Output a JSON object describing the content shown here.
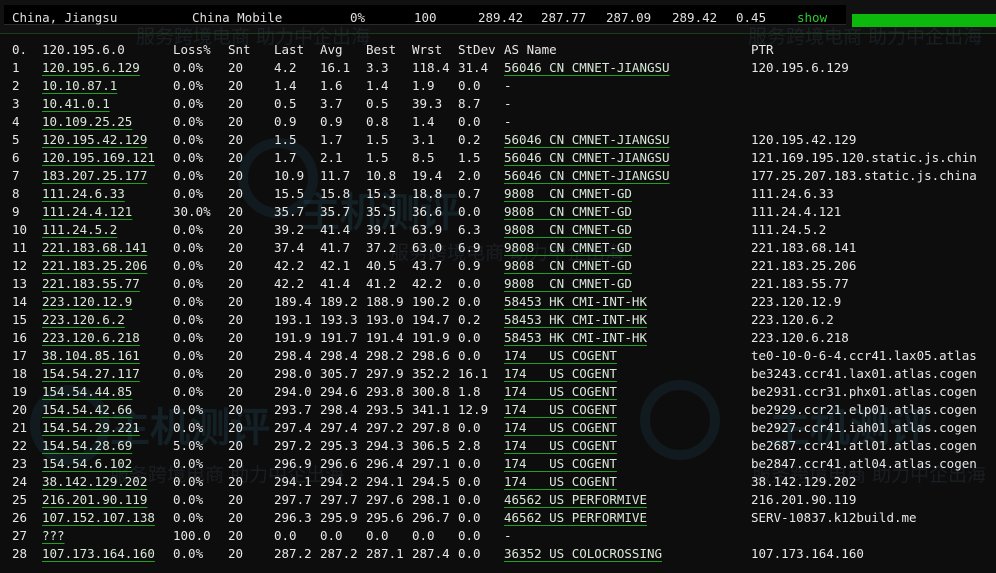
{
  "status": {
    "location": "China, Jiangsu",
    "isp": "China Mobile",
    "loss": "0%",
    "count": "100",
    "v1": "289.42",
    "v2": "287.77",
    "v3": "287.09",
    "v4": "289.42",
    "v5": "0.45",
    "show_label": "show"
  },
  "watermarks": {
    "line1": "服务跨境电商 助力中企出海",
    "brand": "主机测评"
  },
  "header": {
    "idx": "0.",
    "host": "120.195.6.0",
    "loss": "Loss%",
    "snt": "Snt",
    "last": "Last",
    "avg": "Avg",
    "best": "Best",
    "wrst": "Wrst",
    "stdev": "StDev",
    "as": "AS Name",
    "ptr": "PTR"
  },
  "hops": [
    {
      "idx": "1",
      "host": "120.195.6.129",
      "loss": "0.0%",
      "snt": "20",
      "last": "4.2",
      "avg": "16.1",
      "best": "3.3",
      "wrst": "118.4",
      "stdev": "31.4",
      "as": "56046 CN CMNET-JIANGSU",
      "ptr": "120.195.6.129"
    },
    {
      "idx": "2",
      "host": "10.10.87.1",
      "loss": "0.0%",
      "snt": "20",
      "last": "1.4",
      "avg": "1.6",
      "best": "1.4",
      "wrst": "1.9",
      "stdev": "0.0",
      "as": "-",
      "ptr": ""
    },
    {
      "idx": "3",
      "host": "10.41.0.1",
      "loss": "0.0%",
      "snt": "20",
      "last": "0.5",
      "avg": "3.7",
      "best": "0.5",
      "wrst": "39.3",
      "stdev": "8.7",
      "as": "-",
      "ptr": ""
    },
    {
      "idx": "4",
      "host": "10.109.25.25",
      "loss": "0.0%",
      "snt": "20",
      "last": "0.9",
      "avg": "0.9",
      "best": "0.8",
      "wrst": "1.4",
      "stdev": "0.0",
      "as": "-",
      "ptr": ""
    },
    {
      "idx": "5",
      "host": "120.195.42.129",
      "loss": "0.0%",
      "snt": "20",
      "last": "1.5",
      "avg": "1.7",
      "best": "1.5",
      "wrst": "3.1",
      "stdev": "0.2",
      "as": "56046 CN CMNET-JIANGSU",
      "ptr": "120.195.42.129"
    },
    {
      "idx": "6",
      "host": "120.195.169.121",
      "loss": "0.0%",
      "snt": "20",
      "last": "1.7",
      "avg": "2.1",
      "best": "1.5",
      "wrst": "8.5",
      "stdev": "1.5",
      "as": "56046 CN CMNET-JIANGSU",
      "ptr": "121.169.195.120.static.js.chin"
    },
    {
      "idx": "7",
      "host": "183.207.25.177",
      "loss": "0.0%",
      "snt": "20",
      "last": "10.9",
      "avg": "11.7",
      "best": "10.8",
      "wrst": "19.4",
      "stdev": "2.0",
      "as": "56046 CN CMNET-JIANGSU",
      "ptr": "177.25.207.183.static.js.china"
    },
    {
      "idx": "8",
      "host": "111.24.6.33",
      "loss": "0.0%",
      "snt": "20",
      "last": "15.5",
      "avg": "15.8",
      "best": "15.3",
      "wrst": "18.8",
      "stdev": "0.7",
      "as": "9808  CN CMNET-GD",
      "ptr": "111.24.6.33"
    },
    {
      "idx": "9",
      "host": "111.24.4.121",
      "loss": "30.0%",
      "snt": "20",
      "last": "35.7",
      "avg": "35.7",
      "best": "35.5",
      "wrst": "36.6",
      "stdev": "0.0",
      "as": "9808  CN CMNET-GD",
      "ptr": "111.24.4.121"
    },
    {
      "idx": "10",
      "host": "111.24.5.2",
      "loss": "0.0%",
      "snt": "20",
      "last": "39.2",
      "avg": "41.4",
      "best": "39.1",
      "wrst": "63.9",
      "stdev": "6.3",
      "as": "9808  CN CMNET-GD",
      "ptr": "111.24.5.2"
    },
    {
      "idx": "11",
      "host": "221.183.68.141",
      "loss": "0.0%",
      "snt": "20",
      "last": "37.4",
      "avg": "41.7",
      "best": "37.2",
      "wrst": "63.0",
      "stdev": "6.9",
      "as": "9808  CN CMNET-GD",
      "ptr": "221.183.68.141"
    },
    {
      "idx": "12",
      "host": "221.183.25.206",
      "loss": "0.0%",
      "snt": "20",
      "last": "42.2",
      "avg": "42.1",
      "best": "40.5",
      "wrst": "43.7",
      "stdev": "0.9",
      "as": "9808  CN CMNET-GD",
      "ptr": "221.183.25.206"
    },
    {
      "idx": "13",
      "host": "221.183.55.77",
      "loss": "0.0%",
      "snt": "20",
      "last": "42.2",
      "avg": "41.4",
      "best": "41.2",
      "wrst": "42.2",
      "stdev": "0.0",
      "as": "9808  CN CMNET-GD",
      "ptr": "221.183.55.77"
    },
    {
      "idx": "14",
      "host": "223.120.12.9",
      "loss": "0.0%",
      "snt": "20",
      "last": "189.4",
      "avg": "189.2",
      "best": "188.9",
      "wrst": "190.2",
      "stdev": "0.0",
      "as": "58453 HK CMI-INT-HK",
      "ptr": "223.120.12.9"
    },
    {
      "idx": "15",
      "host": "223.120.6.2",
      "loss": "0.0%",
      "snt": "20",
      "last": "193.1",
      "avg": "193.3",
      "best": "193.0",
      "wrst": "194.7",
      "stdev": "0.2",
      "as": "58453 HK CMI-INT-HK",
      "ptr": "223.120.6.2"
    },
    {
      "idx": "16",
      "host": "223.120.6.218",
      "loss": "0.0%",
      "snt": "20",
      "last": "191.9",
      "avg": "191.7",
      "best": "191.4",
      "wrst": "191.9",
      "stdev": "0.0",
      "as": "58453 HK CMI-INT-HK",
      "ptr": "223.120.6.218"
    },
    {
      "idx": "17",
      "host": "38.104.85.161",
      "loss": "0.0%",
      "snt": "20",
      "last": "298.4",
      "avg": "298.4",
      "best": "298.2",
      "wrst": "298.6",
      "stdev": "0.0",
      "as": "174   US COGENT",
      "ptr": "te0-10-0-6-4.ccr41.lax05.atlas"
    },
    {
      "idx": "18",
      "host": "154.54.27.117",
      "loss": "0.0%",
      "snt": "20",
      "last": "298.0",
      "avg": "305.7",
      "best": "297.9",
      "wrst": "352.2",
      "stdev": "16.1",
      "as": "174   US COGENT",
      "ptr": "be3243.ccr41.lax01.atlas.cogen"
    },
    {
      "idx": "19",
      "host": "154.54.44.85",
      "loss": "0.0%",
      "snt": "20",
      "last": "294.0",
      "avg": "294.6",
      "best": "293.8",
      "wrst": "300.8",
      "stdev": "1.8",
      "as": "174   US COGENT",
      "ptr": "be2931.ccr31.phx01.atlas.cogen"
    },
    {
      "idx": "20",
      "host": "154.54.42.66",
      "loss": "0.0%",
      "snt": "20",
      "last": "293.7",
      "avg": "298.4",
      "best": "293.5",
      "wrst": "341.1",
      "stdev": "12.9",
      "as": "174   US COGENT",
      "ptr": "be2929.ccr21.elp01.atlas.cogen"
    },
    {
      "idx": "21",
      "host": "154.54.29.221",
      "loss": "0.0%",
      "snt": "20",
      "last": "297.4",
      "avg": "297.4",
      "best": "297.2",
      "wrst": "297.8",
      "stdev": "0.0",
      "as": "174   US COGENT",
      "ptr": "be2927.ccr41.iah01.atlas.cogen"
    },
    {
      "idx": "22",
      "host": "154.54.28.69",
      "loss": "5.0%",
      "snt": "20",
      "last": "297.2",
      "avg": "295.3",
      "best": "294.3",
      "wrst": "306.5",
      "stdev": "2.8",
      "as": "174   US COGENT",
      "ptr": "be2687.ccr41.atl01.atlas.cogen"
    },
    {
      "idx": "23",
      "host": "154.54.6.102",
      "loss": "0.0%",
      "snt": "20",
      "last": "296.9",
      "avg": "296.6",
      "best": "296.4",
      "wrst": "297.1",
      "stdev": "0.0",
      "as": "174   US COGENT",
      "ptr": "be2847.ccr41.atl04.atlas.cogen"
    },
    {
      "idx": "24",
      "host": "38.142.129.202",
      "loss": "0.0%",
      "snt": "20",
      "last": "294.1",
      "avg": "294.2",
      "best": "294.1",
      "wrst": "294.5",
      "stdev": "0.0",
      "as": "174   US COGENT",
      "ptr": "38.142.129.202"
    },
    {
      "idx": "25",
      "host": "216.201.90.119",
      "loss": "0.0%",
      "snt": "20",
      "last": "297.7",
      "avg": "297.7",
      "best": "297.6",
      "wrst": "298.1",
      "stdev": "0.0",
      "as": "46562 US PERFORMIVE",
      "ptr": "216.201.90.119"
    },
    {
      "idx": "26",
      "host": "107.152.107.138",
      "loss": "0.0%",
      "snt": "20",
      "last": "296.3",
      "avg": "295.9",
      "best": "295.6",
      "wrst": "296.7",
      "stdev": "0.0",
      "as": "46562 US PERFORMIVE",
      "ptr": "SERV-10837.k12build.me"
    },
    {
      "idx": "27",
      "host": "???",
      "loss": "100.0",
      "snt": "20",
      "last": "0.0",
      "avg": "0.0",
      "best": "0.0",
      "wrst": "0.0",
      "stdev": "0.0",
      "as": "-",
      "ptr": ""
    },
    {
      "idx": "28",
      "host": "107.173.164.160",
      "loss": "0.0%",
      "snt": "20",
      "last": "287.2",
      "avg": "287.2",
      "best": "287.1",
      "wrst": "287.4",
      "stdev": "0.0",
      "as": "36352 US COLOCROSSING",
      "ptr": "107.173.164.160"
    }
  ]
}
